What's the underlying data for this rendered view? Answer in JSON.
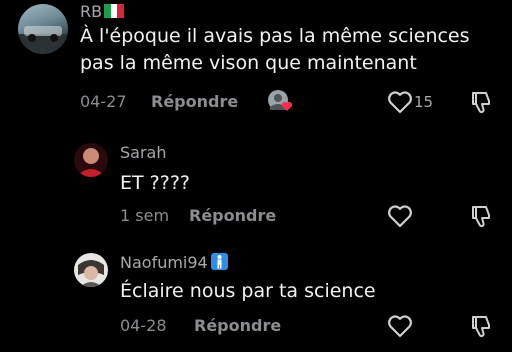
{
  "comments": [
    {
      "username": "RB",
      "text_line1": "À l'époque il avais pas la même sciences",
      "text_line2": "pas la même vison que maintenant",
      "date": "04-27",
      "reply_label": "Répondre",
      "like_count": "15"
    },
    {
      "username": "Sarah",
      "text": "ET ????",
      "date": "1 sem",
      "reply_label": "Répondre"
    },
    {
      "username": "Naofumi94",
      "text": "Éclaire nous par ta science",
      "date": "04-28",
      "reply_label": "Répondre"
    }
  ],
  "icons": {
    "flag": "italy-flag-icon",
    "badge": "man-emoji-icon",
    "heart": "heart-outline-icon",
    "dislike": "thumbs-down-icon",
    "creator_liked": "creator-liked-avatar-icon"
  },
  "colors": {
    "background": "#000000",
    "text": "#f2f2f2",
    "muted": "#8c8c91",
    "accent_heart": "#fe2c55"
  }
}
